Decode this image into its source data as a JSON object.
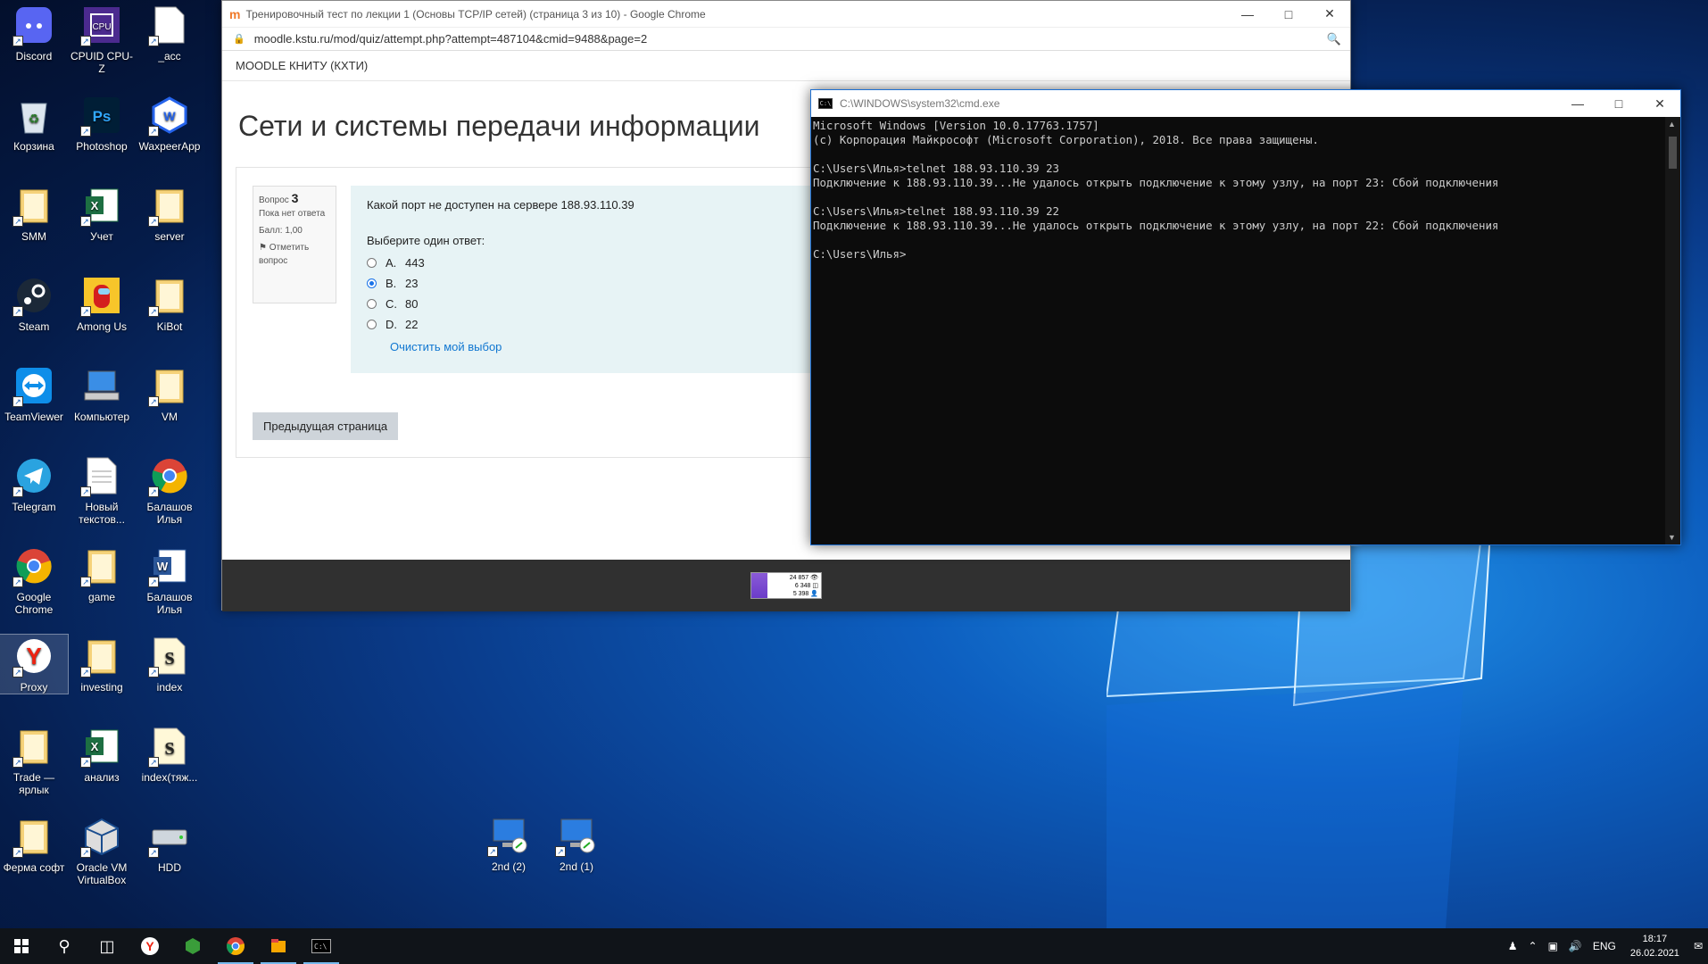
{
  "desktop": {
    "icons": [
      {
        "label": "Discord",
        "icon": "discord-icon"
      },
      {
        "label": "CPUID CPU-Z",
        "icon": "cpuz-icon"
      },
      {
        "label": "_acc",
        "icon": "document-icon"
      },
      {
        "label": "Корзина",
        "icon": "recycle-bin-icon"
      },
      {
        "label": "Photoshop",
        "icon": "photoshop-icon"
      },
      {
        "label": "WaxpeerApp",
        "icon": "waxpeer-icon"
      },
      {
        "label": "SMM",
        "icon": "folder-icon"
      },
      {
        "label": "Учет",
        "icon": "excel-icon"
      },
      {
        "label": "server",
        "icon": "folder-icon"
      },
      {
        "label": "Steam",
        "icon": "steam-icon"
      },
      {
        "label": "Among Us",
        "icon": "among-us-icon"
      },
      {
        "label": "KiBot",
        "icon": "folder-icon"
      },
      {
        "label": "TeamViewer",
        "icon": "teamviewer-icon"
      },
      {
        "label": "Компьютер",
        "icon": "computer-icon"
      },
      {
        "label": "VM",
        "icon": "folder-icon"
      },
      {
        "label": "Telegram",
        "icon": "telegram-icon"
      },
      {
        "label": "Новый текстов...",
        "icon": "text-file-icon"
      },
      {
        "label": "Балашов Илья",
        "icon": "chrome-icon"
      },
      {
        "label": "Google Chrome",
        "icon": "chrome-icon"
      },
      {
        "label": "game",
        "icon": "folder-icon"
      },
      {
        "label": "Балашов Илья",
        "icon": "word-icon"
      },
      {
        "label": "Proxy",
        "icon": "yandex-icon"
      },
      {
        "label": "investing",
        "icon": "folder-icon"
      },
      {
        "label": "index",
        "icon": "script-icon"
      },
      {
        "label": "Trade — ярлык",
        "icon": "folder-icon"
      },
      {
        "label": "анализ",
        "icon": "excel-icon"
      },
      {
        "label": "index(тяж...",
        "icon": "script-icon"
      },
      {
        "label": "Ферма софт",
        "icon": "folder-icon"
      },
      {
        "label": "Oracle VM VirtualBox",
        "icon": "virtualbox-icon"
      },
      {
        "label": "HDD",
        "icon": "drive-icon"
      },
      {
        "label": "2nd (2)",
        "icon": "remote-desktop-icon"
      },
      {
        "label": "2nd (1)",
        "icon": "remote-desktop-icon"
      }
    ]
  },
  "chrome": {
    "title": "Тренировочный тест по лекции 1 (Основы TCP/IP сетей) (страница 3 из 10) - Google Chrome",
    "url": "moodle.kstu.ru/mod/quiz/attempt.php?attempt=487104&cmid=9488&page=2",
    "site_name": "MOODLE КНИТУ (КХТИ)",
    "page_title": "Сети и системы передачи информации",
    "question": {
      "label": "Вопрос",
      "number": "3",
      "status": "Пока нет ответа",
      "score": "Балл: 1,00",
      "flag": "Отметить вопрос",
      "text": "Какой порт не доступен на сервере 188.93.110.39",
      "prompt": "Выберите один ответ:",
      "options": [
        {
          "letter": "A.",
          "value": "443",
          "checked": false
        },
        {
          "letter": "B.",
          "value": "23",
          "checked": true
        },
        {
          "letter": "C.",
          "value": "80",
          "checked": false
        },
        {
          "letter": "D.",
          "value": "22",
          "checked": false
        }
      ],
      "clear": "Очистить мой выбор"
    },
    "prev_button": "Предыдущая страница",
    "counter": [
      "24 857 👁",
      "6 348 ◫",
      "5 398 👤"
    ]
  },
  "cmd": {
    "title": "C:\\WINDOWS\\system32\\cmd.exe",
    "lines": "Microsoft Windows [Version 10.0.17763.1757]\n(c) Корпорация Майкрософт (Microsoft Corporation), 2018. Все права защищены.\n\nC:\\Users\\Илья>telnet 188.93.110.39 23\nПодключение к 188.93.110.39...Не удалось открыть подключение к этому узлу, на порт 23: Сбой подключения\n\nC:\\Users\\Илья>telnet 188.93.110.39 22\nПодключение к 188.93.110.39...Не удалось открыть подключение к этому узлу, на порт 22: Сбой подключения\n\nC:\\Users\\Илья>"
  },
  "taskbar": {
    "language": "ENG",
    "time": "18:17",
    "date": "26.02.2021"
  },
  "colors": {
    "accent": "#1a73e8",
    "link": "#1177d1",
    "question_bg": "#e7f3f5",
    "cmd_bg": "#0c0c0c"
  }
}
